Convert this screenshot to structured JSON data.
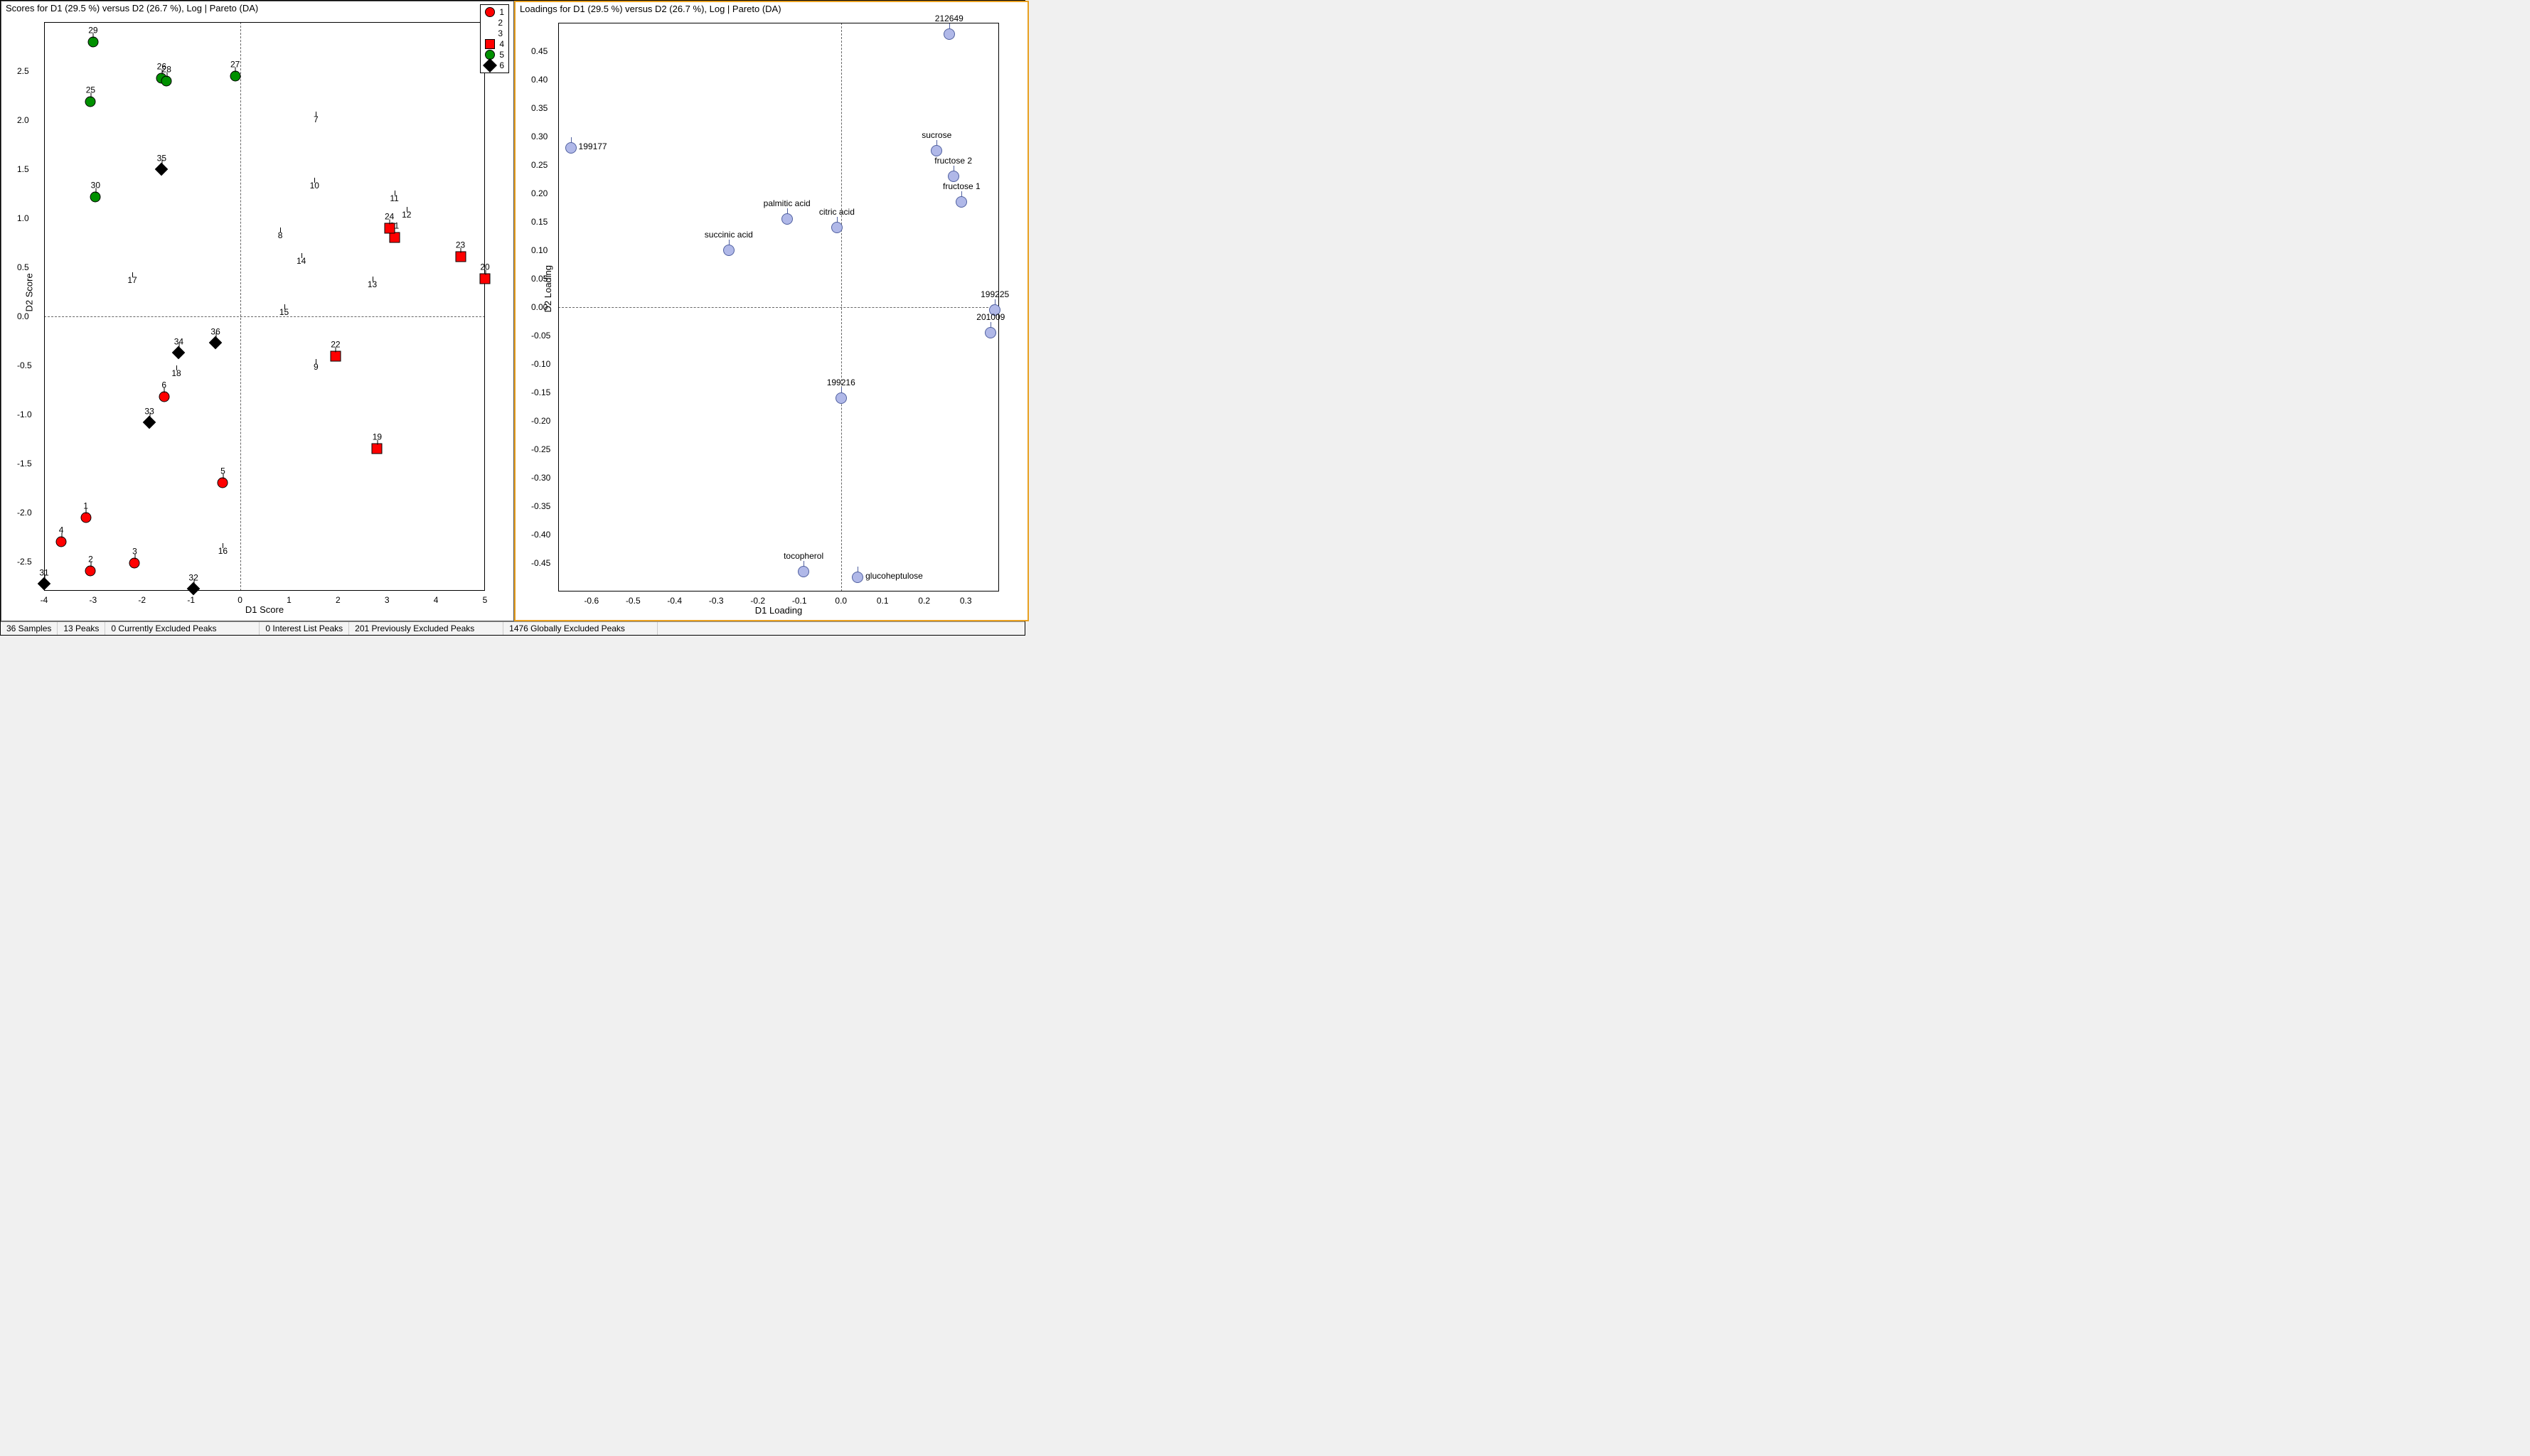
{
  "chart_data": [
    {
      "type": "scatter",
      "title": "Scores for D1 (29.5 %) versus D2 (26.7 %), Log | Pareto (DA)",
      "xlabel": "D1 Score",
      "ylabel": "D2 Score",
      "xlim": [
        -4,
        5
      ],
      "ylim": [
        -2.8,
        3.0
      ],
      "xticks": [
        -4,
        -3,
        -2,
        -1,
        0,
        1,
        2,
        3,
        4,
        5
      ],
      "yticks": [
        -2.5,
        -2.0,
        -1.5,
        -1.0,
        -0.5,
        0.0,
        0.5,
        1.0,
        1.5,
        2.0,
        2.5
      ],
      "legend": [
        {
          "id": "1",
          "shape": "circle",
          "color": "#ff0000"
        },
        {
          "id": "2",
          "shape": "triangle",
          "color": "#009000"
        },
        {
          "id": "3",
          "shape": "triangle",
          "color": "#0000ff"
        },
        {
          "id": "4",
          "shape": "square",
          "color": "#ff0000"
        },
        {
          "id": "5",
          "shape": "circle",
          "color": "#009000"
        },
        {
          "id": "6",
          "shape": "diamond",
          "color": "#000000"
        }
      ],
      "points": [
        {
          "n": "1",
          "g": 1,
          "x": -3.15,
          "y": -2.05
        },
        {
          "n": "2",
          "g": 1,
          "x": -3.05,
          "y": -2.6
        },
        {
          "n": "3",
          "g": 1,
          "x": -2.15,
          "y": -2.52
        },
        {
          "n": "4",
          "g": 1,
          "x": -3.65,
          "y": -2.3
        },
        {
          "n": "5",
          "g": 1,
          "x": -0.35,
          "y": -1.7
        },
        {
          "n": "6",
          "g": 1,
          "x": -1.55,
          "y": -0.82
        },
        {
          "n": "7",
          "g": 2,
          "x": 1.55,
          "y": 1.94
        },
        {
          "n": "8",
          "g": 2,
          "x": 0.82,
          "y": 0.76
        },
        {
          "n": "9",
          "g": 2,
          "x": 1.55,
          "y": -0.58
        },
        {
          "n": "10",
          "g": 2,
          "x": 1.52,
          "y": 1.27
        },
        {
          "n": "11",
          "g": 2,
          "x": 3.15,
          "y": 1.14
        },
        {
          "n": "12",
          "g": 2,
          "x": 3.4,
          "y": 0.97
        },
        {
          "n": "13",
          "g": 3,
          "x": 2.7,
          "y": 0.26
        },
        {
          "n": "14",
          "g": 3,
          "x": 1.25,
          "y": 0.5
        },
        {
          "n": "15",
          "g": 3,
          "x": 0.9,
          "y": -0.02
        },
        {
          "n": "16",
          "g": 3,
          "x": -0.35,
          "y": -2.46
        },
        {
          "n": "17",
          "g": 3,
          "x": -2.2,
          "y": 0.3
        },
        {
          "n": "18",
          "g": 3,
          "x": -1.3,
          "y": -0.65
        },
        {
          "n": "19",
          "g": 4,
          "x": 2.8,
          "y": -1.35
        },
        {
          "n": "20",
          "g": 4,
          "x": 5.0,
          "y": 0.38
        },
        {
          "n": "21",
          "g": 4,
          "x": 3.15,
          "y": 0.8
        },
        {
          "n": "22",
          "g": 4,
          "x": 1.95,
          "y": -0.41
        },
        {
          "n": "23",
          "g": 4,
          "x": 4.5,
          "y": 0.61
        },
        {
          "n": "24",
          "g": 4,
          "x": 3.05,
          "y": 0.9
        },
        {
          "n": "25",
          "g": 5,
          "x": -3.05,
          "y": 2.19
        },
        {
          "n": "26",
          "g": 5,
          "x": -1.6,
          "y": 2.43
        },
        {
          "n": "27",
          "g": 5,
          "x": -0.1,
          "y": 2.45
        },
        {
          "n": "28",
          "g": 5,
          "x": -1.5,
          "y": 2.4
        },
        {
          "n": "29",
          "g": 5,
          "x": -3.0,
          "y": 2.8
        },
        {
          "n": "30",
          "g": 5,
          "x": -2.95,
          "y": 1.22
        },
        {
          "n": "31",
          "g": 6,
          "x": -4.0,
          "y": -2.73
        },
        {
          "n": "32",
          "g": 6,
          "x": -0.95,
          "y": -2.78
        },
        {
          "n": "33",
          "g": 6,
          "x": -1.85,
          "y": -1.08
        },
        {
          "n": "34",
          "g": 6,
          "x": -1.25,
          "y": -0.37
        },
        {
          "n": "35",
          "g": 6,
          "x": -1.6,
          "y": 1.5
        },
        {
          "n": "36",
          "g": 6,
          "x": -0.5,
          "y": -0.27
        }
      ]
    },
    {
      "type": "scatter",
      "title": "Loadings for D1 (29.5 %) versus D2 (26.7 %), Log | Pareto (DA)",
      "xlabel": "D1 Loading",
      "ylabel": "D2 Loading",
      "xlim": [
        -0.68,
        0.38
      ],
      "ylim": [
        -0.5,
        0.5
      ],
      "xticks": [
        -0.6,
        -0.5,
        -0.4,
        -0.3,
        -0.2,
        -0.1,
        0.0,
        0.1,
        0.2,
        0.3
      ],
      "yticks": [
        -0.45,
        -0.4,
        -0.35,
        -0.3,
        -0.25,
        -0.2,
        -0.15,
        -0.1,
        -0.05,
        0.0,
        0.05,
        0.1,
        0.15,
        0.2,
        0.25,
        0.3,
        0.35,
        0.4,
        0.45
      ],
      "points": [
        {
          "n": "212649",
          "x": 0.26,
          "y": 0.48,
          "lp": "top"
        },
        {
          "n": "199177",
          "x": -0.65,
          "y": 0.28,
          "lp": "right"
        },
        {
          "n": "sucrose",
          "x": 0.23,
          "y": 0.275,
          "lp": "top"
        },
        {
          "n": "fructose 2",
          "x": 0.27,
          "y": 0.23,
          "lp": "top"
        },
        {
          "n": "fructose 1",
          "x": 0.29,
          "y": 0.185,
          "lp": "top"
        },
        {
          "n": "palmitic acid",
          "x": -0.13,
          "y": 0.155,
          "lp": "top"
        },
        {
          "n": "citric acid",
          "x": -0.01,
          "y": 0.14,
          "lp": "top"
        },
        {
          "n": "succinic acid",
          "x": -0.27,
          "y": 0.1,
          "lp": "top"
        },
        {
          "n": "199225",
          "x": 0.37,
          "y": -0.005,
          "lp": "top"
        },
        {
          "n": "201009",
          "x": 0.36,
          "y": -0.045,
          "lp": "top"
        },
        {
          "n": "199216",
          "x": 0.0,
          "y": -0.16,
          "lp": "top"
        },
        {
          "n": "tocopherol",
          "x": -0.09,
          "y": -0.465,
          "lp": "top"
        },
        {
          "n": "glucoheptulose",
          "x": 0.04,
          "y": -0.475,
          "lp": "right"
        }
      ]
    }
  ],
  "status": {
    "samples": "36 Samples",
    "peaks": "13 Peaks",
    "curr_excl": "0 Currently Excluded Peaks",
    "interest": "0 Interest List Peaks",
    "prev_excl": "201 Previously Excluded Peaks",
    "glob_excl": "1476 Globally Excluded Peaks"
  }
}
